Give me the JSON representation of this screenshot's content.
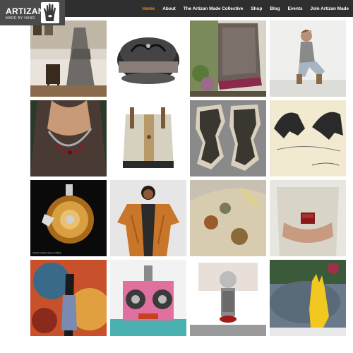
{
  "header": {
    "logo_title": "ARTIZAN",
    "logo_subtitle": "MADE BY HAND",
    "logo_icon": "hand-icon"
  },
  "nav": {
    "items": [
      {
        "label": "Home",
        "active": true
      },
      {
        "label": "About",
        "active": false
      },
      {
        "label": "The Artizan Made Collective",
        "active": false
      },
      {
        "label": "Shop",
        "active": false
      },
      {
        "label": "Blog",
        "active": false
      },
      {
        "label": "Events",
        "active": false
      },
      {
        "label": "Join Artizan Made",
        "active": false
      }
    ]
  },
  "gallery": {
    "tiles": [
      {
        "subject": "dress"
      },
      {
        "subject": "hat"
      },
      {
        "subject": "scarf"
      },
      {
        "subject": "seated-woman"
      },
      {
        "subject": "necklace"
      },
      {
        "subject": "bag"
      },
      {
        "subject": "vases"
      },
      {
        "subject": "print"
      },
      {
        "subject": "pendant",
        "caption": "crystal / sterling silver pendant"
      },
      {
        "subject": "kimono"
      },
      {
        "subject": "silk-scarf"
      },
      {
        "subject": "ring-box"
      },
      {
        "subject": "mural"
      },
      {
        "subject": "robot"
      },
      {
        "subject": "doll"
      },
      {
        "subject": "candle"
      }
    ]
  },
  "colors": {
    "nav_background": "#2f2f2f",
    "logo_background": "#4b4b4b",
    "nav_active": "#f08a1c",
    "nav_text": "#ffffff"
  }
}
